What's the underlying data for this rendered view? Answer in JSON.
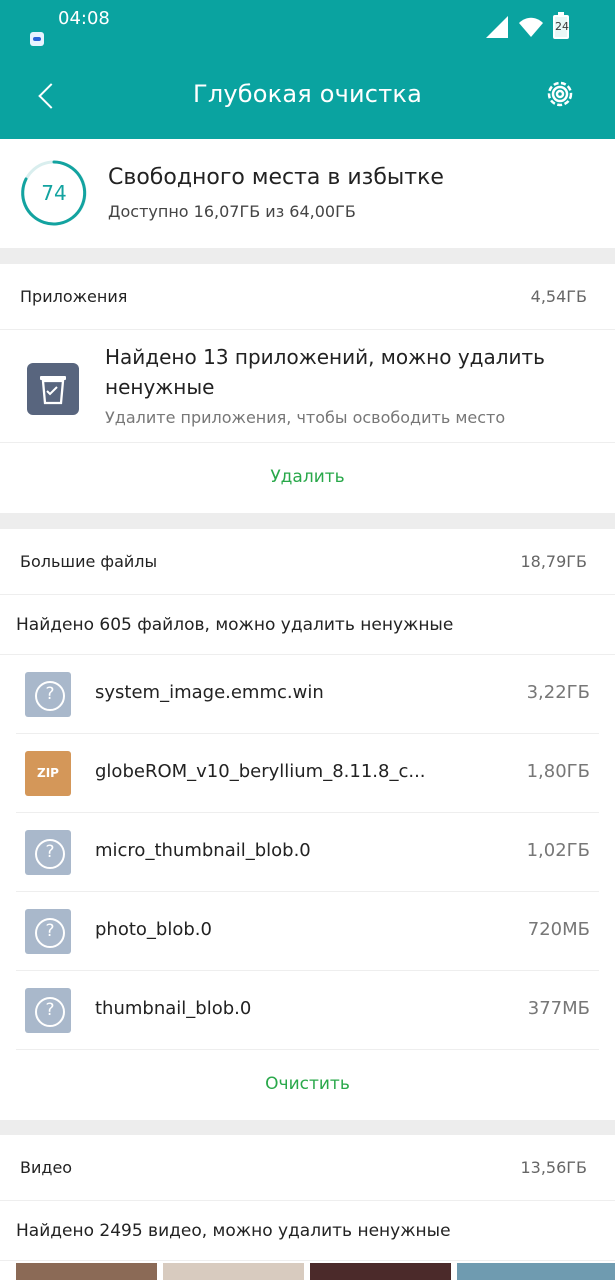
{
  "status_bar": {
    "time": "04:08",
    "battery_level": "24",
    "icons": [
      "notification-icon",
      "signal-icon",
      "wifi-icon",
      "battery-icon"
    ]
  },
  "header": {
    "title": "Глубокая очистка",
    "icons": [
      "back-icon",
      "settings-icon"
    ]
  },
  "storage": {
    "score": "74",
    "title": "Свободного места в избытке",
    "subtitle": "Доступно 16,07ГБ из 64,00ГБ",
    "accent": "#13a3a0"
  },
  "apps_section": {
    "title": "Приложения",
    "size": "4,54ГБ",
    "found_title": "Найдено 13 приложений, можно удалить ненужные",
    "found_desc": "Удалите приложения, чтобы освободить место",
    "action": "Удалить",
    "icon": "trash-bin-icon"
  },
  "files_section": {
    "title": "Большие файлы",
    "size": "18,79ГБ",
    "found": "Найдено 605 файлов, можно удалить ненужные",
    "files": [
      {
        "name": "system_image.emmc.win",
        "size": "3,22ГБ",
        "icon": "unknown"
      },
      {
        "name": "globeROM_v10_beryllium_8.11.8_c...",
        "size": "1,80ГБ",
        "icon": "zip",
        "label": "ZIP"
      },
      {
        "name": "micro_thumbnail_blob.0",
        "size": "1,02ГБ",
        "icon": "unknown"
      },
      {
        "name": "photo_blob.0",
        "size": "720МБ",
        "icon": "unknown"
      },
      {
        "name": "thumbnail_blob.0",
        "size": "377МБ",
        "icon": "unknown"
      }
    ],
    "action": "Очистить"
  },
  "videos_section": {
    "title": "Видео",
    "size": "13,56ГБ",
    "found": "Найдено 2495 видео, можно удалить ненужные"
  },
  "colors": {
    "teal": "#0aa3a0",
    "green_action": "#29a84a",
    "zip_orange": "#d49759",
    "unknown_blue": "#a9b8cb",
    "app_icon": "#58657e"
  }
}
